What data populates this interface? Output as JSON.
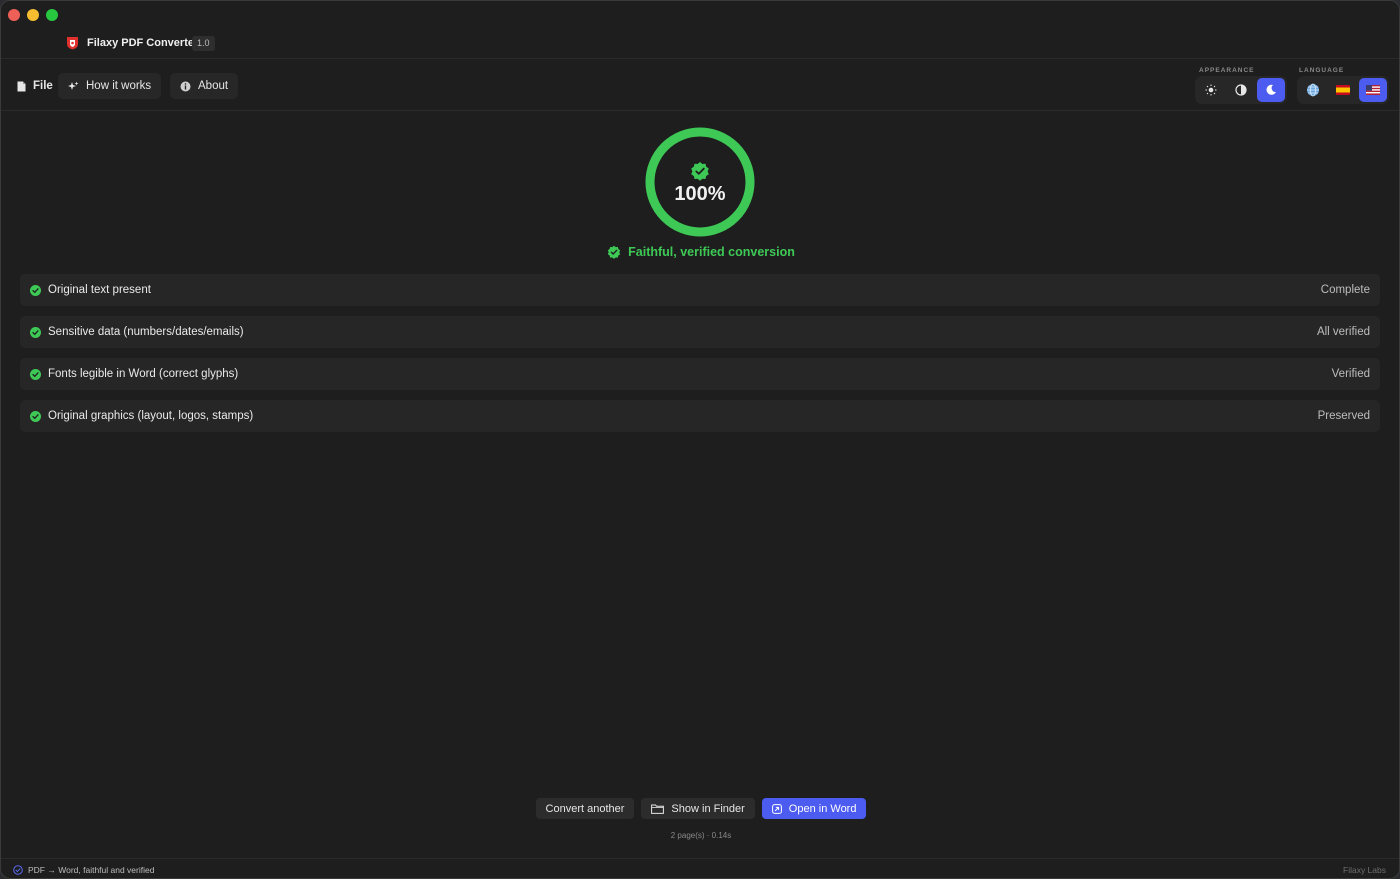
{
  "window": {
    "title": "Filaxy PDF Converter",
    "version": "1.0"
  },
  "toolbar": {
    "file_label": "File",
    "how_label": "How it works",
    "about_label": "About"
  },
  "appearance": {
    "label": "APPEARANCE",
    "options": [
      "sun-icon",
      "contrast-icon",
      "moon-icon"
    ],
    "selected": "moon-icon"
  },
  "language": {
    "label": "LANGUAGE",
    "options": [
      "globe-icon",
      "spain-flag-icon",
      "us-flag-icon"
    ],
    "selected": "us-flag-icon"
  },
  "progress": {
    "percent_text": "100%",
    "value": 100,
    "verdict": "Faithful, verified conversion"
  },
  "checks": [
    {
      "label": "Original text present",
      "status": "Complete"
    },
    {
      "label": "Sensitive data (numbers/dates/emails)",
      "status": "All verified"
    },
    {
      "label": "Fonts legible in Word (correct glyphs)",
      "status": "Verified"
    },
    {
      "label": "Original graphics (layout, logos, stamps)",
      "status": "Preserved"
    }
  ],
  "actions": {
    "convert_another": "Convert another",
    "show_in_finder": "Show in Finder",
    "open_in_word": "Open in Word"
  },
  "meta": "2 page(s) · 0.14s",
  "statusbar": {
    "left": "PDF → Word, faithful and verified",
    "right": "Filaxy Labs"
  },
  "colors": {
    "accent": "#4c5cf0",
    "success": "#3ec956",
    "background": "#1e1e1e"
  }
}
